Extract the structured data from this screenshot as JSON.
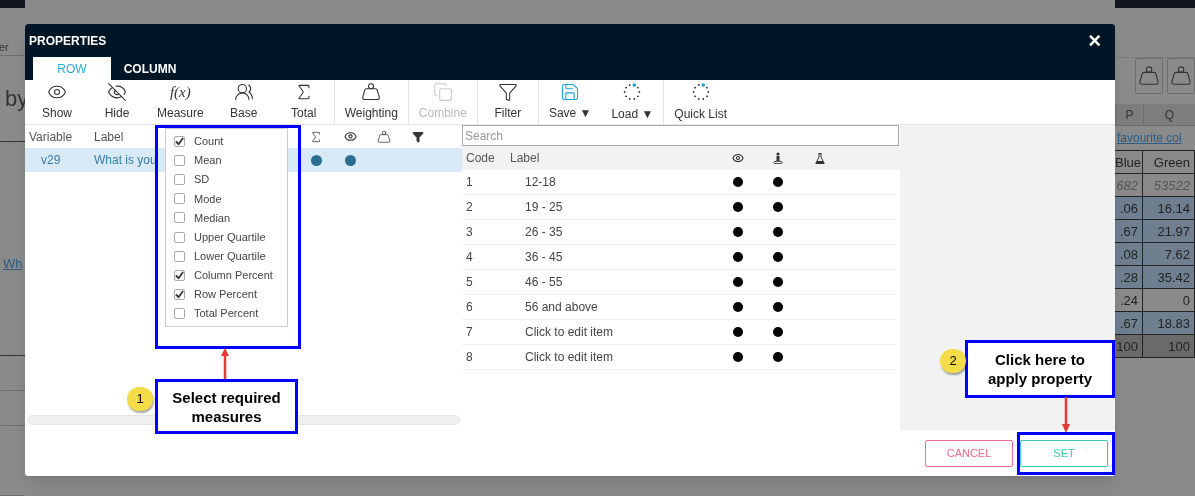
{
  "background_app": {
    "left_texts": [
      "er",
      "by"
    ],
    "link": "Wh",
    "sheet": {
      "columns": [
        "P",
        "Q"
      ],
      "title_link": "favourite col",
      "headers": [
        "Blue",
        "Green"
      ],
      "rows": [
        {
          "cells": [
            "682",
            "53522"
          ],
          "kind": "base"
        },
        {
          "cells": [
            ".06",
            "16.14"
          ],
          "kind": "value"
        },
        {
          "cells": [
            ".67",
            "21.97"
          ],
          "kind": "value"
        },
        {
          "cells": [
            ".08",
            "7.62"
          ],
          "kind": "value"
        },
        {
          "cells": [
            ".28",
            "35.42"
          ],
          "kind": "value"
        },
        {
          "cells": [
            ".24",
            "0"
          ],
          "kind": "plain"
        },
        {
          "cells": [
            ".67",
            "18.83"
          ],
          "kind": "value"
        },
        {
          "cells": [
            "100",
            "100"
          ],
          "kind": "total"
        }
      ]
    }
  },
  "dialog": {
    "title": "PROPERTIES",
    "close": "×",
    "tabs": [
      {
        "label": "ROW",
        "selected": true
      },
      {
        "label": "COLUMN",
        "selected": false
      }
    ],
    "toolbar_groups": [
      [
        {
          "label": "Show",
          "disabled": false
        },
        {
          "label": "Hide",
          "disabled": false
        },
        {
          "label": "Measure",
          "glyph": "f(x)",
          "disabled": false
        },
        {
          "label": "Base",
          "disabled": false
        },
        {
          "label": "Total",
          "disabled": false
        }
      ],
      [
        {
          "label": "Weighting",
          "disabled": false
        }
      ],
      [
        {
          "label": "Combine",
          "disabled": true
        }
      ],
      [
        {
          "label": "Filter",
          "disabled": false
        }
      ],
      [
        {
          "label": "Save ▼",
          "disabled": false
        },
        {
          "label": "Load ▼",
          "disabled": false
        }
      ],
      [
        {
          "label": "Quick List",
          "disabled": false
        }
      ]
    ],
    "variables": {
      "columns": [
        "Variable",
        "Label"
      ],
      "rows": [
        {
          "variable": "v29",
          "label": "What is you",
          "selected": true,
          "total": true,
          "visible": true,
          "weighted": false,
          "filtered": false
        }
      ]
    },
    "measures": [
      {
        "label": "Count",
        "checked": true
      },
      {
        "label": "Mean",
        "checked": false
      },
      {
        "label": "SD",
        "checked": false
      },
      {
        "label": "Mode",
        "checked": false
      },
      {
        "label": "Median",
        "checked": false
      },
      {
        "label": "Upper Quartile",
        "checked": false
      },
      {
        "label": "Lower Quartile",
        "checked": false
      },
      {
        "label": "Column Percent",
        "checked": true
      },
      {
        "label": "Row Percent",
        "checked": true
      },
      {
        "label": "Total Percent",
        "checked": false
      }
    ],
    "codes": {
      "search": {
        "placeholder": "Search"
      },
      "columns": [
        "Code",
        "Label"
      ],
      "rows": [
        {
          "code": "1",
          "label": "12-18",
          "visible": true,
          "base": true,
          "test": false
        },
        {
          "code": "2",
          "label": "19 - 25",
          "visible": true,
          "base": true,
          "test": false
        },
        {
          "code": "3",
          "label": "26 - 35",
          "visible": true,
          "base": true,
          "test": false
        },
        {
          "code": "4",
          "label": "36 - 45",
          "visible": true,
          "base": true,
          "test": false
        },
        {
          "code": "5",
          "label": "46 - 55",
          "visible": true,
          "base": true,
          "test": false
        },
        {
          "code": "6",
          "label": "56 and above",
          "visible": true,
          "base": true,
          "test": false
        },
        {
          "code": "7",
          "label": "Click to edit item",
          "visible": true,
          "base": true,
          "test": false
        },
        {
          "code": "8",
          "label": "Click to edit item",
          "visible": true,
          "base": true,
          "test": false
        }
      ]
    },
    "buttons": {
      "cancel": "CANCEL",
      "set": "SET"
    }
  },
  "annotations": [
    {
      "number": "1",
      "text": "Select required measures"
    },
    {
      "number": "2",
      "text": "Click here to apply property"
    }
  ]
}
